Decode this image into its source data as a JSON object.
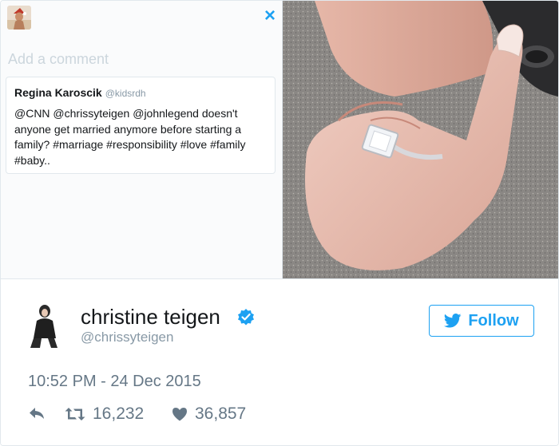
{
  "composer": {
    "placeholder": "Add a comment",
    "close_label": "×"
  },
  "quoted_tweet": {
    "name": "Regina Karoscik",
    "handle": "@kidsrdh",
    "text": "@CNN @chrissyteigen @johnlegend doesn't anyone get married anymore before starting a family? #marriage #responsibility #love #family #baby.."
  },
  "tweet": {
    "display_name": "christine teigen",
    "handle": "@chrissyteigen",
    "follow_label": "Follow",
    "timestamp": "10:52 PM - 24 Dec 2015",
    "retweets": "16,232",
    "likes": "36,857"
  },
  "colors": {
    "accent": "#1da1f2",
    "muted": "#657786",
    "border": "#e1e8ed"
  },
  "icons": [
    "close-icon",
    "verified-badge-icon",
    "twitter-bird-icon",
    "reply-icon",
    "retweet-icon",
    "heart-icon"
  ]
}
